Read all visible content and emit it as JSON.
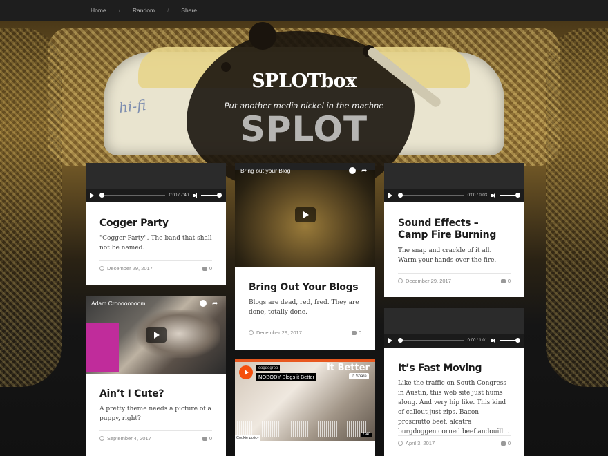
{
  "nav": {
    "items": [
      "Home",
      "Random",
      "Share"
    ]
  },
  "site": {
    "title": "SPLOTbox",
    "tagline": "Put another media nickel in the machne",
    "hero_text_hifi": "hi-fi",
    "hero_text_splot": "SPLOT"
  },
  "cards": {
    "cogger": {
      "audio_time": "0:00 / 7:40",
      "title": "Cogger Party",
      "excerpt": "\"Cogger Party\". The band that shall not be named.",
      "date": "December 29, 2017",
      "comments": "0"
    },
    "cute": {
      "video_title": "Adam Croooooooom",
      "title": "Ain’t I Cute?",
      "excerpt": "A pretty theme needs a picture of a puppy, right?",
      "date": "September 4, 2017",
      "comments": "0"
    },
    "blogs": {
      "video_title": "Bring out your Blog",
      "title": "Bring Out Your Blogs",
      "excerpt": "Blogs are dead, red, fred. They are done, totally done.",
      "date": "December 29, 2017",
      "comments": "0"
    },
    "sc": {
      "user": "cogdogroo",
      "track": "NOBODY Blogs it Better",
      "share": "Share",
      "overlay": "It Better",
      "duration": "7:40",
      "cookie": "Cookie policy"
    },
    "camp": {
      "audio_time": "0:00 / 0:03",
      "title": "Sound Effects – Camp Fire Burning",
      "excerpt": "The snap and crackle of it all. Warm your hands over the fire.",
      "date": "December 29, 2017",
      "comments": "0"
    },
    "fast": {
      "audio_time": "0:00 / 1:01",
      "title": "It’s Fast Moving",
      "excerpt": "Like the traffic on South Congress in Austin, this web site just hums along. And very hip like. This kind of callout just zips. Bacon prosciutto beef, alcatra burgdoggen corned beef andouill…",
      "date": "April 3, 2017",
      "comments": "0"
    }
  },
  "icons": [
    "play-icon",
    "volume-icon",
    "clock-icon",
    "share-icon",
    "comment-icon"
  ]
}
